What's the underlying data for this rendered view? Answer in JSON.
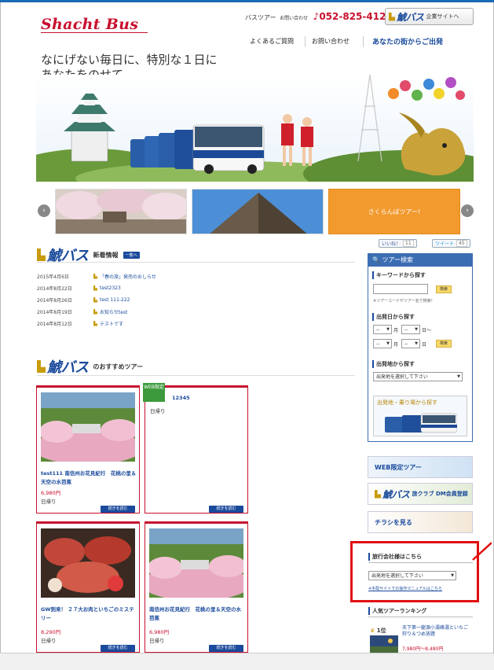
{
  "header": {
    "logo": "Shacht Bus",
    "phone_label": "バスツアー",
    "phone_small": "お問い合わせ",
    "phone_number": "052-825-4120",
    "corporate_brand": "鯱バス",
    "corporate_link": "企業サイトへ",
    "nav": [
      "よくあるご質問",
      "お問い合わせ",
      "あなたの街からご出発"
    ]
  },
  "hero": {
    "tagline": "なにげない毎日に、特別な１日に\nあなたをのせて。"
  },
  "carousel": {
    "prev": "‹",
    "next": "›",
    "orange_label": "さくらんぼツアー!"
  },
  "social": {
    "like": "いいね！",
    "like_count": "11",
    "tweet": "ツイート",
    "tweet_count": "45"
  },
  "news": {
    "brand": "鯱バス",
    "title": "新着情報",
    "list_button": "一覧へ",
    "items": [
      {
        "date": "2015年4月6日",
        "text": "「春の旅」発売のおしらせ"
      },
      {
        "date": "2014年8月22日",
        "text": "test2323"
      },
      {
        "date": "2014年8月26日",
        "text": "test 111-222"
      },
      {
        "date": "2014年8月19日",
        "text": "お知らせtest"
      },
      {
        "date": "2014年8月12日",
        "text": "テストです"
      }
    ]
  },
  "recommend": {
    "brand": "鯱バス",
    "title": "のおすすめツアー",
    "web_badge": "WEB限定",
    "cards": [
      {
        "name": "test111 南信州お花見紀行　花桃の里＆天空の水芭蕉",
        "price": "6,980円",
        "day": "日帰り",
        "more": "続きを読む"
      },
      {
        "name": "12345",
        "price": "",
        "day": "日帰り",
        "more": "続きを読む"
      },
      {
        "name": "GW到来！ ２７大お肉といちごのミステリー",
        "price": "8,290円",
        "day": "日帰り",
        "more": "続きを読む"
      },
      {
        "name": "南信州お花見紀行　花桃の里＆天空の水芭蕉",
        "price": "6,980円",
        "day": "日帰り",
        "more": "続きを読む"
      }
    ]
  },
  "search": {
    "header": "ツアー検索",
    "keyword_label": "キーワードから探す",
    "search_btn": "検索",
    "note": "※ツアーコードやツアー名で検索！",
    "date_label": "出発日から探す",
    "month": "月",
    "day_from": "日～",
    "day": "日",
    "dash": "--",
    "place_label": "出発地から探す",
    "place_select": "出発地を選択して下さい",
    "map_label": "出発地・乗り場から探す"
  },
  "banners": [
    "WEB限定ツアー",
    "旅クラブ DM会員登録",
    "チラシを見る"
  ],
  "banner_brand": "鯱バス",
  "agency": {
    "title": "旅行会社様はこちら",
    "select": "出発地を選択して下さい",
    "link": "※手配サイトでの操作マニュアルはこちら"
  },
  "ranking": {
    "title": "人気ツアーランキング",
    "pos": "1位",
    "name": "天下第一龍源小湯峰湯といちご狩り＆つめ放題",
    "price": "7,980円～8,480円"
  }
}
